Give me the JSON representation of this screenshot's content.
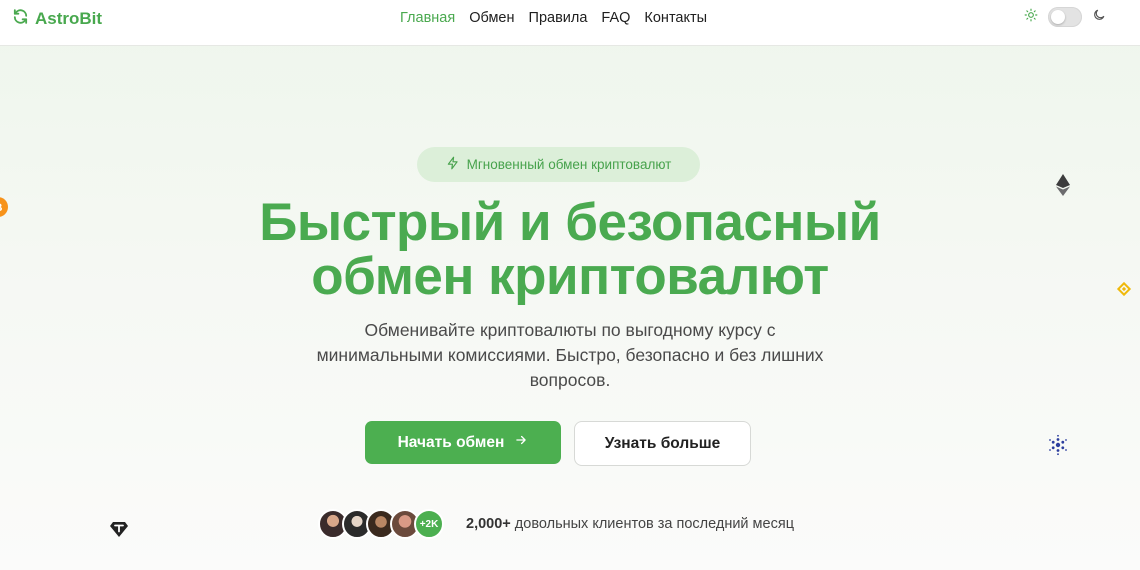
{
  "brand": {
    "name": "AstroBit",
    "color": "#4aa94f"
  },
  "nav": {
    "items": [
      {
        "label": "Главная",
        "active": true
      },
      {
        "label": "Обмен",
        "active": false
      },
      {
        "label": "Правила",
        "active": false
      },
      {
        "label": "FAQ",
        "active": false
      },
      {
        "label": "Контакты",
        "active": false
      }
    ]
  },
  "theme": {
    "mode": "light",
    "icons": [
      "sun-icon",
      "moon-icon"
    ]
  },
  "hero": {
    "badge": "Мгновенный обмен криптовалют",
    "title_line1": "Быстрый и безопасный",
    "title_line2": "обмен криптовалют",
    "subtitle": "Обменивайте криптовалюты по выгодному курсу с минимальными комиссиями. Быстро, безопасно и без лишних вопросов.",
    "primary_button": "Начать обмен",
    "secondary_button": "Узнать больше"
  },
  "social_proof": {
    "avatar_count_badge": "+2K",
    "count": "2,000+",
    "text": "довольных клиентов за последний месяц"
  },
  "floating_icons": [
    "bitcoin-icon",
    "ethereum-icon",
    "binance-coin-icon",
    "cardano-icon",
    "tether-icon"
  ],
  "colors": {
    "accent": "#4caf50",
    "title": "#4aaa50",
    "badge_bg": "#dcefd9",
    "bitcoin": "#f7931a",
    "binance": "#f0b90b",
    "cardano": "#2c3e9e"
  }
}
